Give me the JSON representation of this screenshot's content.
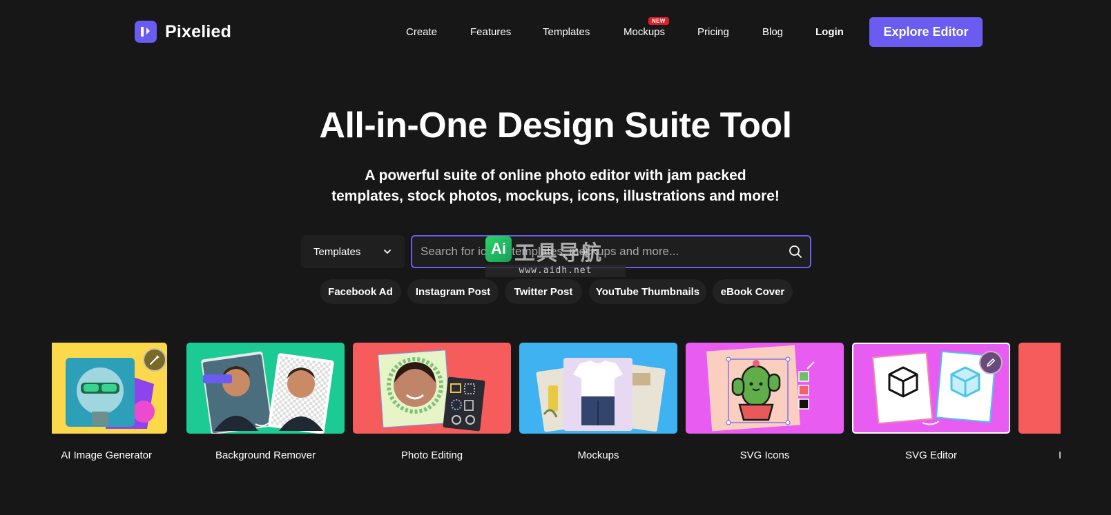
{
  "brand": {
    "name": "Pixelied",
    "accent": "#6a5cf0"
  },
  "nav": {
    "items": [
      {
        "label": "Create"
      },
      {
        "label": "Features"
      },
      {
        "label": "Templates"
      },
      {
        "label": "Mockups",
        "badge": "NEW"
      },
      {
        "label": "Pricing"
      },
      {
        "label": "Blog"
      },
      {
        "label": "Login"
      }
    ],
    "cta_label": "Explore Editor"
  },
  "hero": {
    "title": "All-in-One Design Suite Tool",
    "subtitle_line1": "A powerful suite of online photo editor with jam packed",
    "subtitle_line2": "templates, stock photos, mockups, icons, illustrations and more!"
  },
  "search": {
    "category_selected": "Templates",
    "placeholder": "Search for icons, templates, mockups and more...",
    "value": ""
  },
  "quick_tags": [
    "Facebook Ad",
    "Instagram Post",
    "Twitter Post",
    "YouTube Thumbnails",
    "eBook Cover"
  ],
  "features": [
    {
      "label": "AI Image Generator",
      "bg": "#fcd84b"
    },
    {
      "label": "Background Remover",
      "bg": "#1ccb94"
    },
    {
      "label": "Photo Editing",
      "bg": "#f65c5c"
    },
    {
      "label": "Mockups",
      "bg": "#3fb2f2"
    },
    {
      "label": "SVG Icons",
      "bg": "#e85cf2"
    },
    {
      "label": "SVG Editor",
      "bg": "#e85cf2"
    },
    {
      "label": "I",
      "bg": "#f65c5c"
    }
  ],
  "watermark": {
    "badge": "Ai",
    "text": "工具导航",
    "url": "www.aidh.net"
  }
}
